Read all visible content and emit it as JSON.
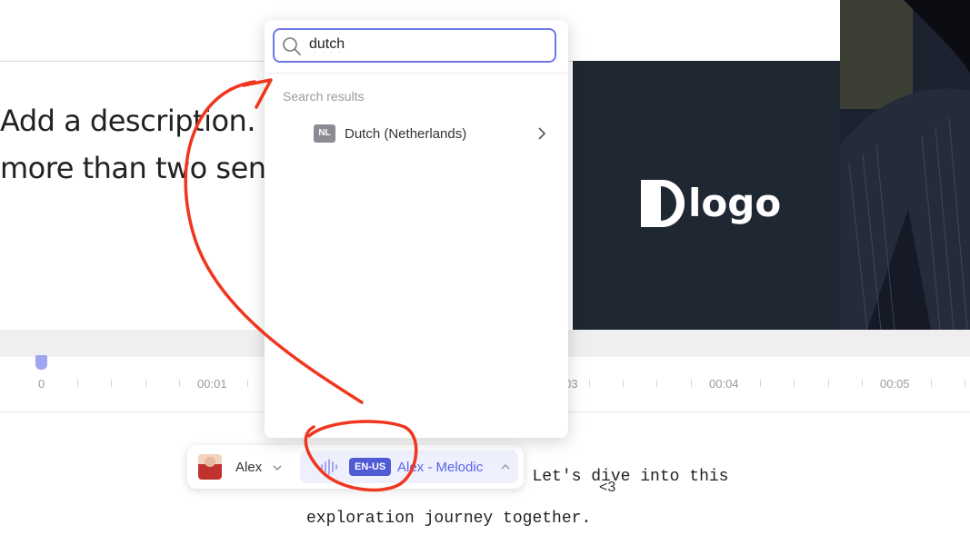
{
  "slide": {
    "description": "Add a description. U\nmore than two sen",
    "logo_text": "logo"
  },
  "timeline": {
    "labels": [
      "0",
      "00:01",
      "00:03",
      "00:04",
      "00:05"
    ]
  },
  "script": {
    "text": "he Corporate Training. Let's dive into this\nexploration journey together.",
    "cursor_glyph": "<3"
  },
  "voice_bar": {
    "avatar_name": "Alex",
    "language_code": "EN-US",
    "voice_name": "Alex - Melodic"
  },
  "dropdown": {
    "search_value": "dutch",
    "section_label": "Search results",
    "results": [
      {
        "flag": "NL",
        "label": "Dutch (Netherlands)"
      }
    ]
  },
  "colors": {
    "accent": "#5865e6",
    "annotation": "#f0361e",
    "logo_panel": "#1f2732"
  },
  "icons": [
    "search-icon",
    "chevron-right-icon",
    "chevron-down-icon",
    "chevron-up-icon",
    "waveform-icon",
    "logo-mark-icon"
  ]
}
